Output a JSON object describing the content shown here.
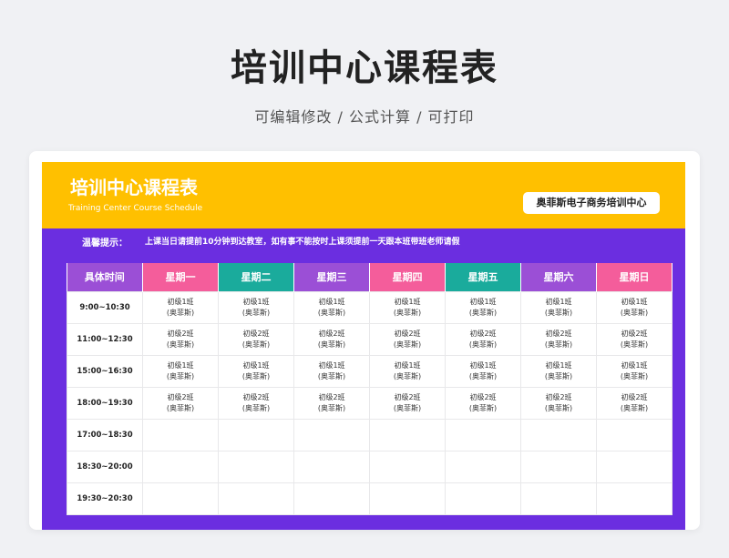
{
  "header": {
    "title": "培训中心课程表",
    "subtitle": "可编辑修改 /  公式计算  /  可打印"
  },
  "banner": {
    "title": "培训中心课程表",
    "english": "Training Center Course Schedule",
    "org": "奥菲斯电子商务培训中心",
    "color": "#ffc000"
  },
  "notice": {
    "label": "温馨提示：",
    "text": "上课当日请提前10分钟到达教室，如有事不能按时上课须提前一天跟本班带班老师请假"
  },
  "colors": {
    "sheet_bg": "#6b2ee0",
    "purple": "#9b4fd6",
    "pink": "#f45d9b",
    "teal": "#1aab9c"
  },
  "table": {
    "headers": [
      {
        "label": "具体时间",
        "color": "#9b4fd6"
      },
      {
        "label": "星期一",
        "color": "#f45d9b"
      },
      {
        "label": "星期二",
        "color": "#1aab9c"
      },
      {
        "label": "星期三",
        "color": "#9b4fd6"
      },
      {
        "label": "星期四",
        "color": "#f45d9b"
      },
      {
        "label": "星期五",
        "color": "#1aab9c"
      },
      {
        "label": "星期六",
        "color": "#9b4fd6"
      },
      {
        "label": "星期日",
        "color": "#f45d9b"
      }
    ],
    "rows": [
      {
        "time": "9:00~10:30",
        "cells": [
          [
            "初级1班",
            "(奥菲斯)"
          ],
          [
            "初级1班",
            "(奥菲斯)"
          ],
          [
            "初级1班",
            "(奥菲斯)"
          ],
          [
            "初级1班",
            "(奥菲斯)"
          ],
          [
            "初级1班",
            "(奥菲斯)"
          ],
          [
            "初级1班",
            "(奥菲斯)"
          ],
          [
            "初级1班",
            "(奥菲斯)"
          ]
        ]
      },
      {
        "time": "11:00~12:30",
        "cells": [
          [
            "初级2班",
            "(奥菲斯)"
          ],
          [
            "初级2班",
            "(奥菲斯)"
          ],
          [
            "初级2班",
            "(奥菲斯)"
          ],
          [
            "初级2班",
            "(奥菲斯)"
          ],
          [
            "初级2班",
            "(奥菲斯)"
          ],
          [
            "初级2班",
            "(奥菲斯)"
          ],
          [
            "初级2班",
            "(奥菲斯)"
          ]
        ]
      },
      {
        "time": "15:00~16:30",
        "cells": [
          [
            "初级1班",
            "(奥菲斯)"
          ],
          [
            "初级1班",
            "(奥菲斯)"
          ],
          [
            "初级1班",
            "(奥菲斯)"
          ],
          [
            "初级1班",
            "(奥菲斯)"
          ],
          [
            "初级1班",
            "(奥菲斯)"
          ],
          [
            "初级1班",
            "(奥菲斯)"
          ],
          [
            "初级1班",
            "(奥菲斯)"
          ]
        ]
      },
      {
        "time": "18:00~19:30",
        "cells": [
          [
            "初级2班",
            "(奥菲斯)"
          ],
          [
            "初级2班",
            "(奥菲斯)"
          ],
          [
            "初级2班",
            "(奥菲斯)"
          ],
          [
            "初级2班",
            "(奥菲斯)"
          ],
          [
            "初级2班",
            "(奥菲斯)"
          ],
          [
            "初级2班",
            "(奥菲斯)"
          ],
          [
            "初级2班",
            "(奥菲斯)"
          ]
        ]
      },
      {
        "time": "17:00~18:30",
        "cells": [
          [],
          [],
          [],
          [],
          [],
          [],
          []
        ]
      },
      {
        "time": "18:30~20:00",
        "cells": [
          [],
          [],
          [],
          [],
          [],
          [],
          []
        ]
      },
      {
        "time": "19:30~20:30",
        "cells": [
          [],
          [],
          [],
          [],
          [],
          [],
          []
        ]
      }
    ]
  }
}
